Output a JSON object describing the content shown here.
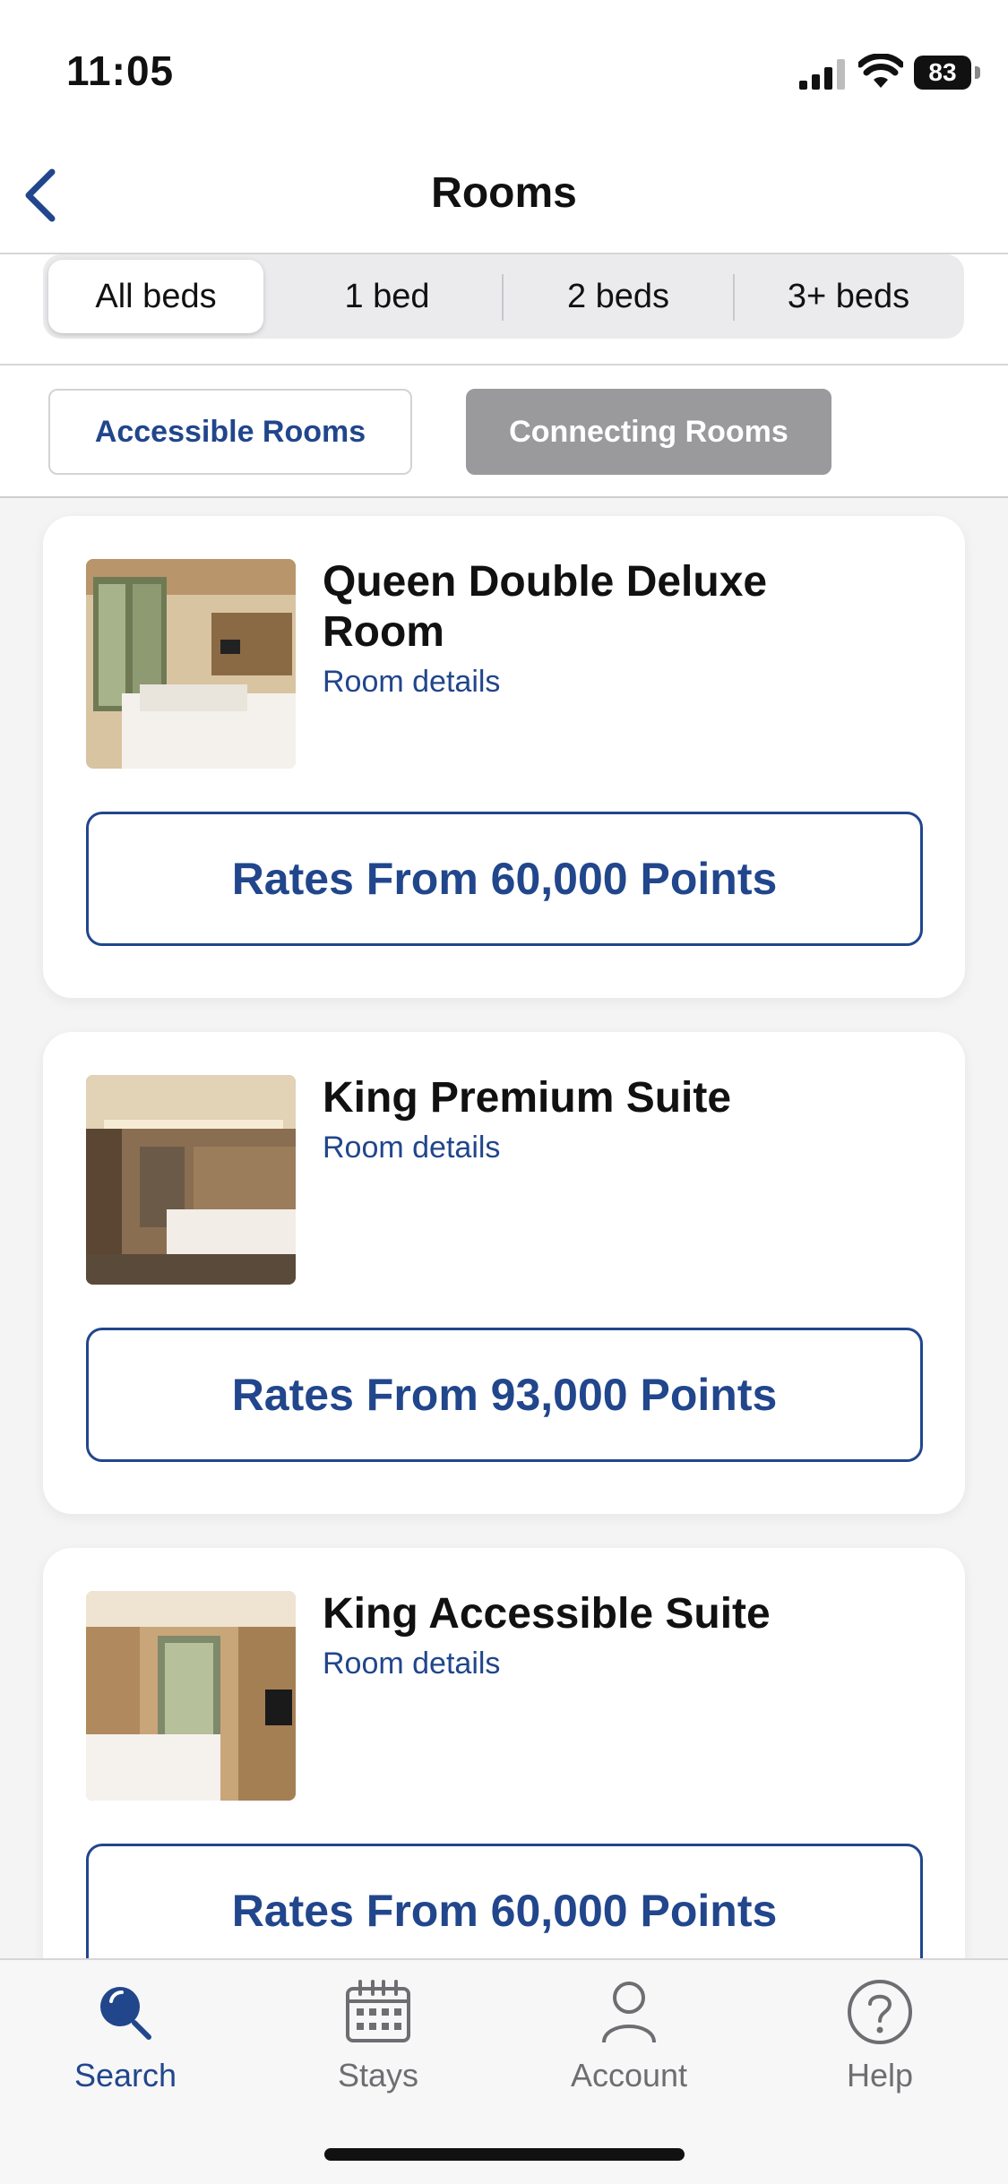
{
  "status": {
    "time": "11:05",
    "battery": "83"
  },
  "nav": {
    "title": "Rooms"
  },
  "bed_filter": {
    "options": [
      "All beds",
      "1 bed",
      "2 beds",
      "3+ beds"
    ],
    "selected": "All beds"
  },
  "room_filters": {
    "accessible": "Accessible Rooms",
    "connecting": "Connecting Rooms"
  },
  "rooms": [
    {
      "name": "Queen Double Deluxe Room",
      "details_link": "Room details",
      "rate": "Rates From 60,000 Points"
    },
    {
      "name": "King Premium Suite",
      "details_link": "Room details",
      "rate": "Rates From 93,000 Points"
    },
    {
      "name": "King Accessible Suite",
      "details_link": "Room details",
      "rate": "Rates From 60,000 Points"
    }
  ],
  "tabbar": {
    "items": [
      {
        "label": "Search",
        "icon": "search-icon",
        "active": true
      },
      {
        "label": "Stays",
        "icon": "calendar-icon",
        "active": false
      },
      {
        "label": "Account",
        "icon": "person-icon",
        "active": false
      },
      {
        "label": "Help",
        "icon": "help-icon",
        "active": false
      }
    ]
  },
  "colors": {
    "accent": "#21468c",
    "inactive_tab": "#6e6e72",
    "disabled_fill": "#9a9a9c"
  }
}
